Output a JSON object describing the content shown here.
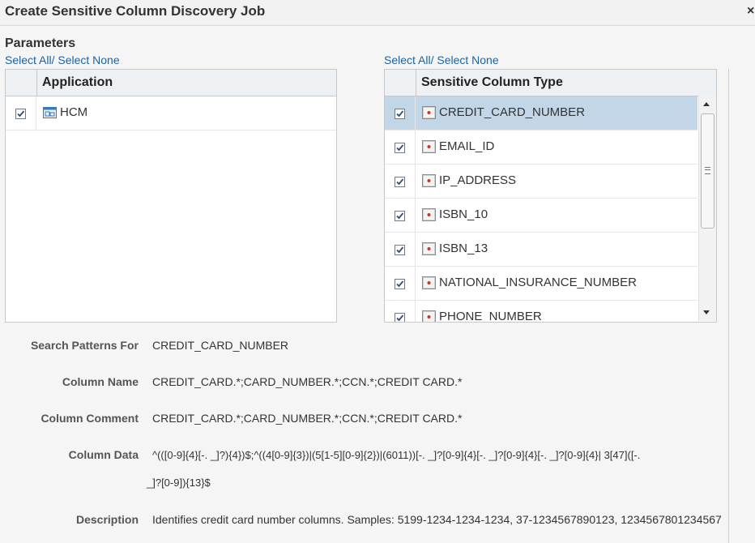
{
  "dialog": {
    "title": "Create Sensitive Column Discovery Job",
    "close_label": "×"
  },
  "parameters": {
    "heading": "Parameters"
  },
  "application_table": {
    "select_link": "Select All/ Select None",
    "header": "Application",
    "rows": [
      {
        "label": "HCM",
        "checked": true,
        "icon": "application-icon"
      }
    ]
  },
  "sensitive_table": {
    "select_link": "Select All/ Select None",
    "header": "Sensitive Column Type",
    "rows": [
      {
        "label": "CREDIT_CARD_NUMBER",
        "checked": true,
        "selected": true,
        "icon": "sensitive-type-icon"
      },
      {
        "label": "EMAIL_ID",
        "checked": true,
        "selected": false,
        "icon": "sensitive-type-icon"
      },
      {
        "label": "IP_ADDRESS",
        "checked": true,
        "selected": false,
        "icon": "sensitive-type-icon"
      },
      {
        "label": "ISBN_10",
        "checked": true,
        "selected": false,
        "icon": "sensitive-type-icon"
      },
      {
        "label": "ISBN_13",
        "checked": true,
        "selected": false,
        "icon": "sensitive-type-icon"
      },
      {
        "label": "NATIONAL_INSURANCE_NUMBER",
        "checked": true,
        "selected": false,
        "icon": "sensitive-type-icon"
      },
      {
        "label": "PHONE_NUMBER",
        "checked": true,
        "selected": false,
        "icon": "sensitive-type-icon"
      }
    ]
  },
  "details": {
    "search_patterns_label": "Search Patterns For",
    "search_patterns_value": "CREDIT_CARD_NUMBER",
    "column_name_label": "Column Name",
    "column_name_value": "CREDIT_CARD.*;CARD_NUMBER.*;CCN.*;CREDIT CARD.*",
    "column_comment_label": "Column Comment",
    "column_comment_value": "CREDIT_CARD.*;CARD_NUMBER.*;CCN.*;CREDIT CARD.*",
    "column_data_label": "Column Data",
    "column_data_line1": "^(([0-9]{4}[-. _]?){4})$;^((4[0-9]{3})|(5[1-5][0-9]{2})|(6011))[-. _]?[0-9]{4}[-. _]?[0-9]{4}[-. _]?[0-9]{4}| 3[47]([-.",
    "column_data_line2": "_]?[0-9]){13}$",
    "description_label": "Description",
    "description_value": "Identifies credit card number columns. Samples: 5199-1234-1234-1234, 37-1234567890123, 1234567801234567"
  },
  "colors": {
    "link": "#1a63a6",
    "selected_row": "#c2d6e7",
    "header_bg": "#eef1f4",
    "icon_red": "#c0392b",
    "app_icon_blue": "#3a78b5"
  }
}
